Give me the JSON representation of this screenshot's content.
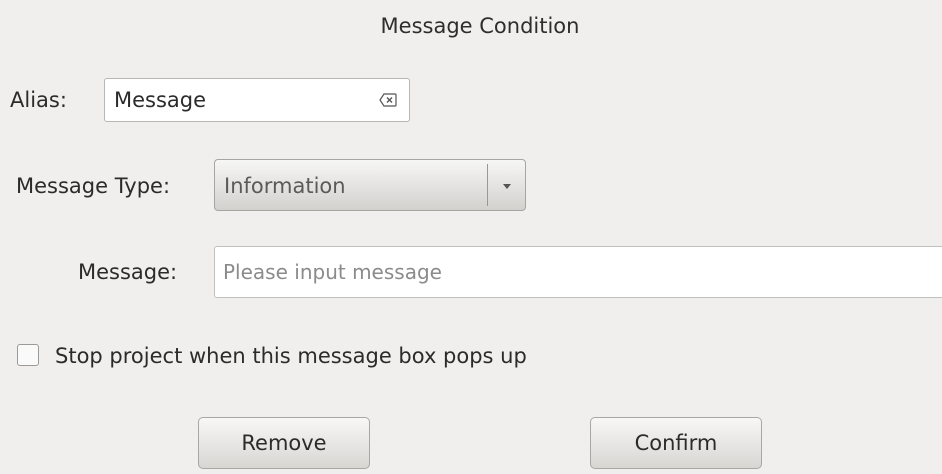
{
  "dialog": {
    "title": "Message Condition"
  },
  "form": {
    "alias_label": "Alias:",
    "alias_value": "Message",
    "message_type_label": "Message Type:",
    "message_type_selected": "Information",
    "message_label": "Message:",
    "message_value": "",
    "message_placeholder": "Please input message",
    "stop_project_label": "Stop project when this message box pops up",
    "stop_project_checked": false
  },
  "buttons": {
    "remove": "Remove",
    "confirm": "Confirm"
  },
  "icons": {
    "alias_clear": "clear-text-icon",
    "type_dropdown": "chevron-down-icon"
  },
  "colors": {
    "background": "#f0efee",
    "input_background": "#ffffff",
    "text": "#2b2b2b",
    "placeholder": "#8b8b8b"
  }
}
